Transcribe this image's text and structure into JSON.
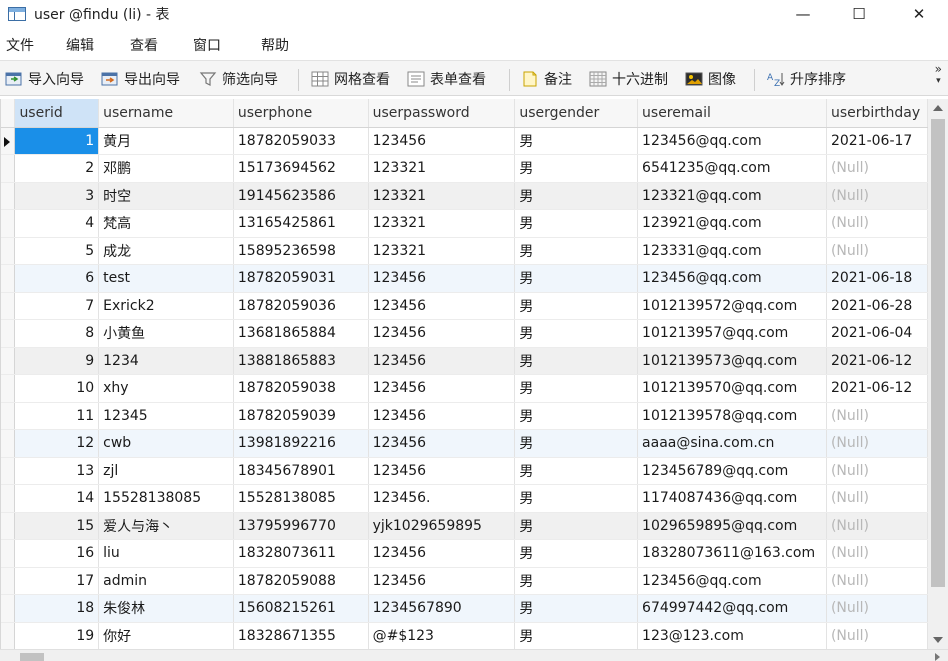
{
  "window": {
    "title": "user @findu (li) - 表",
    "minimize_glyph": "—",
    "maximize_glyph": "☐",
    "close_glyph": "✕"
  },
  "menu": [
    "文件",
    "编辑",
    "查看",
    "窗口",
    "帮助"
  ],
  "toolbar": {
    "import_wizard": "导入向导",
    "export_wizard": "导出向导",
    "filter_wizard": "筛选向导",
    "grid_view": "网格查看",
    "form_view": "表单查看",
    "memo": "备注",
    "hex": "十六进制",
    "image": "图像",
    "sort_asc": "升序排序",
    "overflow_glyph": "»"
  },
  "table": {
    "columns": [
      "userid",
      "username",
      "userphone",
      "userpassword",
      "usergender",
      "useremail",
      "userbirthday"
    ],
    "rows": [
      [
        "1",
        "黄月",
        "18782059033",
        "123456",
        "男",
        "123456@qq.com",
        "2021-06-17"
      ],
      [
        "2",
        "邓鹏",
        "15173694562",
        "123321",
        "男",
        "6541235@qq.com",
        "(Null)"
      ],
      [
        "3",
        "时空",
        "19145623586",
        "123321",
        "男",
        "123321@qq.com",
        "(Null)"
      ],
      [
        "4",
        "梵高",
        "13165425861",
        "123321",
        "男",
        "123921@qq.com",
        "(Null)"
      ],
      [
        "5",
        "成龙",
        "15895236598",
        "123321",
        "男",
        "123331@qq.com",
        "(Null)"
      ],
      [
        "6",
        "test",
        "18782059031",
        "123456",
        "男",
        "123456@qq.com",
        "2021-06-18"
      ],
      [
        "7",
        "Exrick2",
        "18782059036",
        "123456",
        "男",
        "1012139572@qq.com",
        "2021-06-28"
      ],
      [
        "8",
        "小黄鱼",
        "13681865884",
        "123456",
        "男",
        "101213957@qq.com",
        "2021-06-04"
      ],
      [
        "9",
        "1234",
        "13881865883",
        "123456",
        "男",
        "1012139573@qq.com",
        "2021-06-12"
      ],
      [
        "10",
        "xhy",
        "18782059038",
        "123456",
        "男",
        "1012139570@qq.com",
        "2021-06-12"
      ],
      [
        "11",
        "12345",
        "18782059039",
        "123456",
        "男",
        "1012139578@qq.com",
        "(Null)"
      ],
      [
        "12",
        "cwb",
        "13981892216",
        "123456",
        "男",
        "aaaa@sina.com.cn",
        "(Null)"
      ],
      [
        "13",
        "zjl",
        "18345678901",
        "123456",
        "男",
        "123456789@qq.com",
        "(Null)"
      ],
      [
        "14",
        "15528138085",
        "15528138085",
        "123456.",
        "男",
        "1174087436@qq.com",
        "(Null)"
      ],
      [
        "15",
        "爱人与海丶",
        "13795996770",
        "yjk1029659895",
        "男",
        "1029659895@qq.com",
        "(Null)"
      ],
      [
        "16",
        "liu",
        "18328073611",
        "123456",
        "男",
        "18328073611@163.com",
        "(Null)"
      ],
      [
        "17",
        "admin",
        "18782059088",
        "123456",
        "男",
        "123456@qq.com",
        "(Null)"
      ],
      [
        "18",
        "朱俊林",
        "15608215261",
        "1234567890",
        "男",
        "674997442@qq.com",
        "(Null)"
      ],
      [
        "19",
        "你好",
        "18328671355",
        "@#$123",
        "男",
        "123@123.com",
        "(Null)"
      ]
    ],
    "selected_row": 0,
    "selected_column": "userid",
    "alt_rows": [
      5,
      11,
      17
    ],
    "gray_rows": [
      2,
      8,
      14
    ]
  },
  "colors": {
    "selection": "#1a8fe8",
    "null_text": "#b7b7b7",
    "header_selected": "#cfe3f7",
    "row_highlight": "#f0f6fc"
  }
}
